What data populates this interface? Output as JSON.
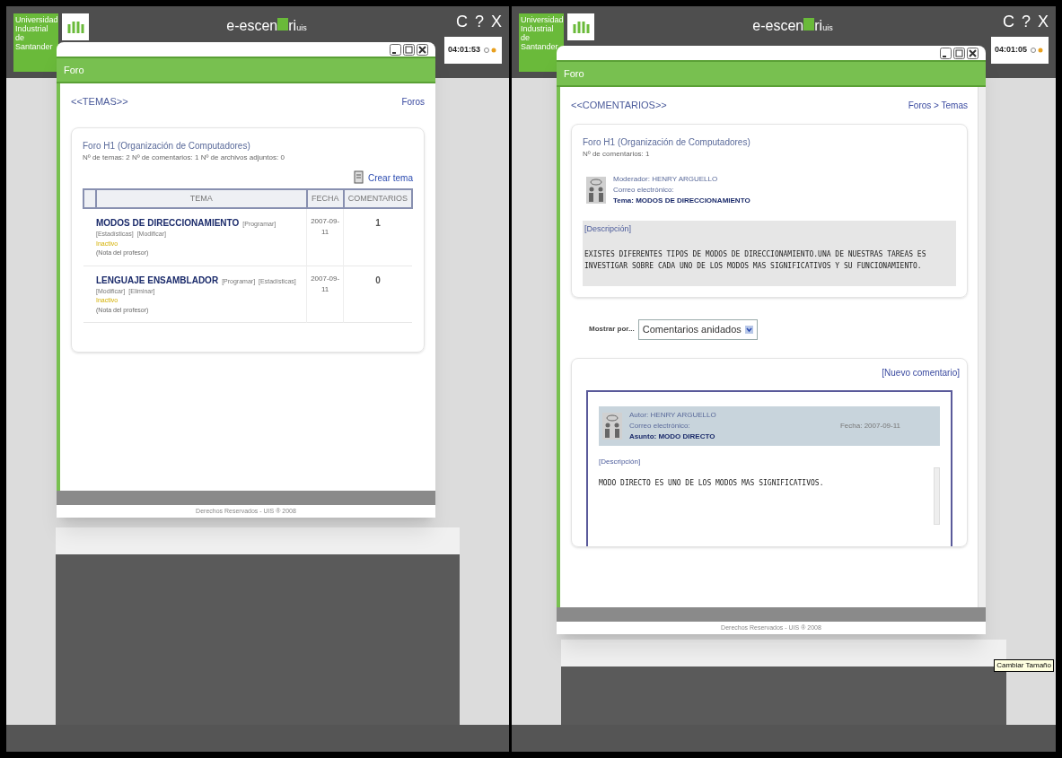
{
  "screens": [
    {
      "kind": "topics",
      "university": "Universidad Industrial de Santander",
      "app_title": {
        "before": "e-escen",
        "after": "ri",
        "suffix": "uis"
      },
      "top_buttons": [
        "C",
        "?",
        "X"
      ],
      "clock": "04:01:53",
      "window": {
        "title": "Foro",
        "footer": "Derechos Reservados - UIS ® 2008"
      },
      "breadcrumb": "<<TEMAS>>",
      "nav_link": "Foros",
      "forum": {
        "title": "Foro H1 (Organización de Computadores)",
        "stats": "Nº de temas: 2 Nº de comentarios: 1 Nº de archivos adjuntos: 0"
      },
      "create_link": "Crear tema",
      "table": {
        "columns": [
          "TEMA",
          "FECHA",
          "COMENTARIOS"
        ],
        "rows": [
          {
            "title": "MODOS DE DIRECCIONAMIENTO",
            "actions": [
              "[Programar]",
              "[Estadísticas]",
              "[Modificar]"
            ],
            "status": "Inactivo",
            "note": "(Nota del profesor)",
            "date": "2007-09-11",
            "comments": "1"
          },
          {
            "title": "LENGUAJE ENSAMBLADOR",
            "actions": [
              "[Programar]",
              "[Estadísticas]",
              "[Modificar]",
              "[Eliminar]"
            ],
            "status": "Inactivo",
            "note": "(Nota del profesor)",
            "date": "2007-09-11",
            "comments": "0"
          }
        ]
      }
    },
    {
      "kind": "comments",
      "university": "Universidad Industrial de Santander",
      "app_title": {
        "before": "e-escen",
        "after": "ri",
        "suffix": "uis"
      },
      "top_buttons": [
        "C",
        "?",
        "X"
      ],
      "clock": "04:01:05",
      "window": {
        "title": "Foro",
        "footer": "Derechos Reservados - UIS ® 2008"
      },
      "breadcrumb": "<<COMENTARIOS>>",
      "nav_link": "Foros > Temas",
      "forum": {
        "title": "Foro H1 (Organización de Computadores)",
        "stats": "Nº de comentarios: 1"
      },
      "topic": {
        "moderator": "Moderador: HENRY ARGUELLO",
        "email": "Correo electrónico:",
        "subject": "Tema: MODOS DE DIRECCIONAMIENTO",
        "description_label": "[Descripción]",
        "description": "EXISTES DIFERENTES TIPOS DE MODOS DE DIRECCIONAMIENTO.UNA DE NUESTRAS TAREAS ES INVESTIGAR SOBRE CADA UNO DE LOS MODOS MAS SIGNIFICATIVOS Y SU FUNCIONAMIENTO."
      },
      "sort": {
        "label": "Mostrar por...",
        "value": "Comentarios anidados"
      },
      "new_comment_link": "[Nuevo comentario]",
      "comments": [
        {
          "author": "Autor: HENRY ARGUELLO",
          "email": "Correo electrónico:",
          "subject": "Asunto: MODO DIRECTO",
          "date": "Fecha: 2007-09-11",
          "description_label": "[Descripción]",
          "body": "MODO DIRECTO ES UNO DE LOS MODOS MAS SIGNIFICATIVOS."
        }
      ],
      "tooltip": "Cambiar Tamaño"
    }
  ]
}
